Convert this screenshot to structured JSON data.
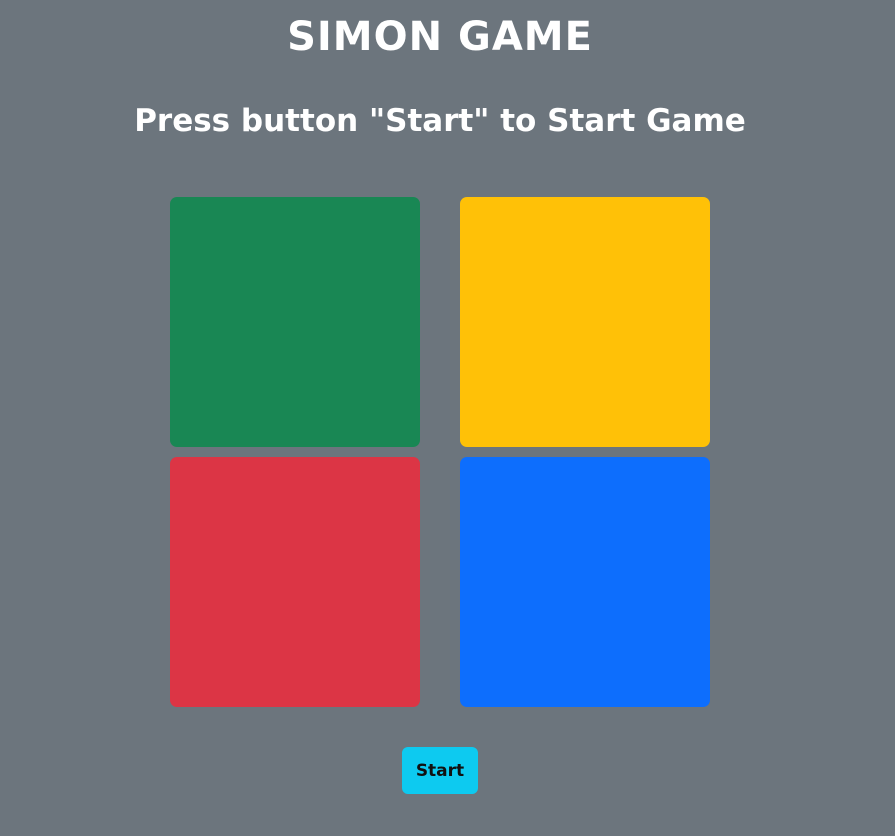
{
  "title": "SIMON GAME",
  "status_text": "Press button \"Start\" to Start Game",
  "pads": [
    {
      "id": "green",
      "color": "#198754"
    },
    {
      "id": "yellow",
      "color": "#ffc107"
    },
    {
      "id": "red",
      "color": "#dc3545"
    },
    {
      "id": "blue",
      "color": "#0d6efd"
    }
  ],
  "start_button": {
    "label": "Start",
    "color": "#0dcaf0"
  },
  "background_color": "#6c757d"
}
